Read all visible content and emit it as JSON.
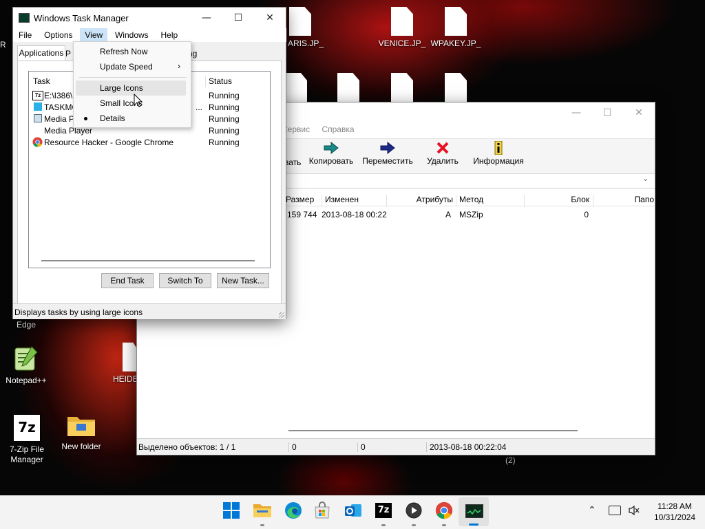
{
  "desktop": {
    "icons": [
      {
        "label": "R"
      },
      {
        "label": "ARIS.JP_"
      },
      {
        "label": "VENICE.JP_"
      },
      {
        "label": "WPAKEY.JP_"
      },
      {
        "label": "Edge"
      },
      {
        "label": "Notepad++"
      },
      {
        "label": "HEIDE"
      },
      {
        "label": "7-Zip File Manager"
      },
      {
        "label": "New folder"
      }
    ],
    "stray_label": "(2)"
  },
  "taskmgr": {
    "title": "Windows Task Manager",
    "menu": [
      "File",
      "Options",
      "View",
      "Windows",
      "Help"
    ],
    "tabs": [
      "Applications",
      "P",
      "ng"
    ],
    "columns": [
      "Task",
      "Status"
    ],
    "rows": [
      {
        "task": "E:\\I386\\",
        "status": "Running",
        "icon": "7zip-icon"
      },
      {
        "task": "TASKMGI",
        "trail": "...",
        "status": "Running",
        "icon": "taskmgr-icon"
      },
      {
        "task": "Media Pla",
        "status": "Running",
        "icon": "media-player-icon"
      },
      {
        "task": "Media Player",
        "status": "Running",
        "icon": "blank-icon"
      },
      {
        "task": "Resource Hacker - Google Chrome",
        "status": "Running",
        "icon": "chrome-icon"
      }
    ],
    "buttons": {
      "end_task": "End Task",
      "switch_to": "Switch To",
      "new_task": "New Task..."
    },
    "statusbar": "Displays tasks by using large icons"
  },
  "view_menu": {
    "items": [
      {
        "label": "Refresh Now"
      },
      {
        "label": "Update Speed",
        "submenu": true
      },
      {
        "label": "Large Icons",
        "highlighted": true
      },
      {
        "label": "Small Icons"
      },
      {
        "label": "Details",
        "bullet": true
      }
    ]
  },
  "sevenzip": {
    "menu": [
      "Сервис",
      "Справка"
    ],
    "toolbar": [
      {
        "label": "вать",
        "icon": "extract-icon"
      },
      {
        "label": "Копировать",
        "icon": "copy-arrow-icon"
      },
      {
        "label": "Переместить",
        "icon": "move-arrow-icon"
      },
      {
        "label": "Удалить",
        "icon": "delete-x-icon"
      },
      {
        "label": "Информация",
        "icon": "info-icon"
      }
    ],
    "columns": [
      "Размер",
      "Изменен",
      "Атрибуты",
      "Метод",
      "Блок",
      "Папо"
    ],
    "row": {
      "size": "159 744",
      "modified": "2013-08-18 00:22",
      "attr": "A",
      "method": "MSZip",
      "block": "0"
    },
    "status": {
      "selected": "Выделено объектов: 1 / 1",
      "s1": "0",
      "s2": "0",
      "date": "2013-08-18 00:22:04"
    }
  },
  "taskbar": {
    "apps": [
      "windows-start-icon",
      "file-explorer-icon",
      "edge-icon",
      "store-icon",
      "outlook-icon",
      "7zip-icon",
      "media-player-icon",
      "chrome-icon",
      "taskmgr-icon"
    ],
    "time": "11:28 AM",
    "date": "10/31/2024"
  },
  "colors": {
    "accent": "#0078d7",
    "highlight": "#e5e5e5",
    "delete": "#e81123",
    "arrow_teal": "#1a8a8a",
    "arrow_navy": "#1a2b8a"
  }
}
